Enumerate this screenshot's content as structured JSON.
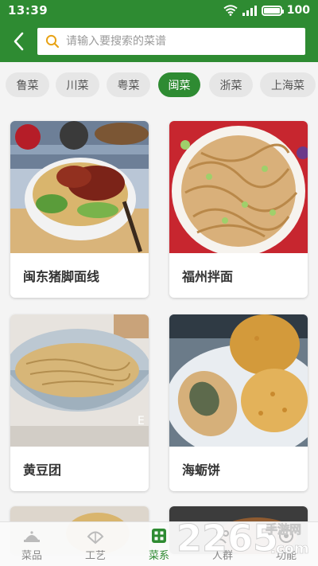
{
  "status": {
    "time": "13:39",
    "battery": "100",
    "battery_level": 1.0
  },
  "search": {
    "placeholder": "请输入要搜索的菜谱"
  },
  "tabs": [
    {
      "label": "鲁菜",
      "active": false
    },
    {
      "label": "川菜",
      "active": false
    },
    {
      "label": "粤菜",
      "active": false
    },
    {
      "label": "闽菜",
      "active": true
    },
    {
      "label": "浙菜",
      "active": false
    },
    {
      "label": "上海菜",
      "active": false
    }
  ],
  "dishes": [
    {
      "name": "闽东猪脚面线",
      "icon": "pork-trotter-noodles-photo"
    },
    {
      "name": "福州拌面",
      "icon": "fuzhou-mixed-noodles-photo"
    },
    {
      "name": "黄豆团",
      "icon": "soybean-ball-photo"
    },
    {
      "name": "海蛎饼",
      "icon": "oyster-cake-photo"
    }
  ],
  "bottom_nav": [
    {
      "label": "菜品",
      "icon": "dish-cover-icon",
      "active": false
    },
    {
      "label": "工艺",
      "icon": "craft-fan-icon",
      "active": false
    },
    {
      "label": "菜系",
      "icon": "grid-icon",
      "active": true
    },
    {
      "label": "人群",
      "icon": "people-icon",
      "active": false
    },
    {
      "label": "功能",
      "icon": "function-icon",
      "active": false
    }
  ],
  "watermark": {
    "brand": "2265",
    "suffix": "手游网",
    "site": ".com"
  },
  "colors": {
    "primary": "#2e8b32",
    "search_icon": "#e8a317",
    "background": "#f4f4f4"
  }
}
